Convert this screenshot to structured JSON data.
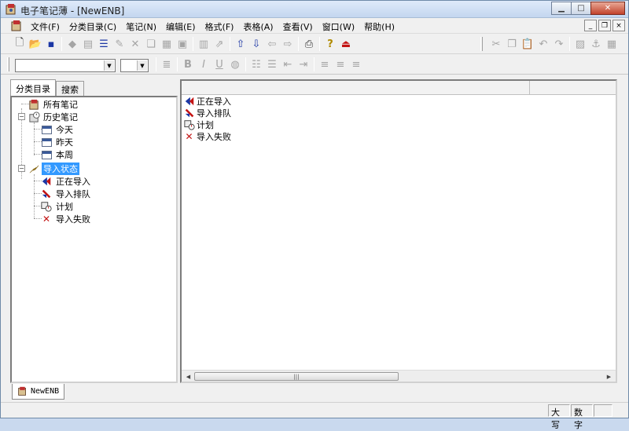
{
  "window": {
    "title": "电子笔记薄 - [NewENB]"
  },
  "menu": [
    "文件(F)",
    "分类目录(C)",
    "笔记(N)",
    "编辑(E)",
    "格式(F)",
    "表格(A)",
    "查看(V)",
    "窗口(W)",
    "帮助(H)"
  ],
  "toolbar2": {
    "bold": "B",
    "italic": "I",
    "underline": "U"
  },
  "tabs": [
    "分类目录",
    "搜索"
  ],
  "tree": [
    {
      "label": "所有笔记",
      "icon": "all-notes-icon"
    },
    {
      "label": "历史笔记",
      "icon": "history-icon"
    },
    {
      "label": "今天",
      "icon": "calendar-icon"
    },
    {
      "label": "昨天",
      "icon": "calendar-icon"
    },
    {
      "label": "本周",
      "icon": "calendar-icon"
    },
    {
      "label": "导入状态",
      "icon": "import-status-icon"
    },
    {
      "label": "正在导入",
      "icon": "importing-icon"
    },
    {
      "label": "导入排队",
      "icon": "import-queue-icon"
    },
    {
      "label": "计划",
      "icon": "plan-icon"
    },
    {
      "label": "导入失败",
      "icon": "import-failed-icon"
    }
  ],
  "list": [
    {
      "label": "正在导入"
    },
    {
      "label": "导入排队"
    },
    {
      "label": "计划"
    },
    {
      "label": "导入失败"
    }
  ],
  "doc_tab": "NewENB",
  "status": {
    "caps": "大写",
    "num": "数字"
  }
}
